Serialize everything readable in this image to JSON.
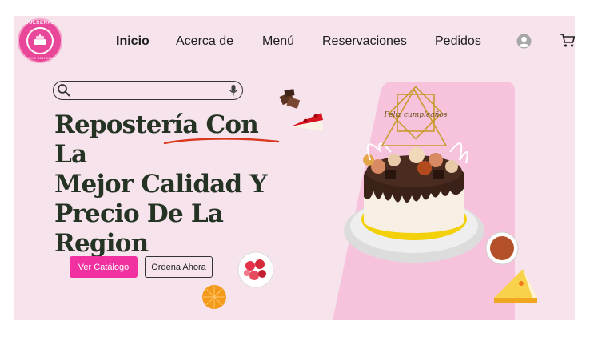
{
  "brand": {
    "logo_top": "DULCENAE",
    "logo_bottom": "HECHO CON AMOR"
  },
  "nav": {
    "items": [
      {
        "label": "Inicio",
        "active": true
      },
      {
        "label": "Acerca de",
        "active": false
      },
      {
        "label": "Menú",
        "active": false
      },
      {
        "label": "Reservaciones",
        "active": false
      },
      {
        "label": "Pedidos",
        "active": false
      }
    ],
    "icons": [
      "user-icon",
      "cart-icon"
    ]
  },
  "search": {
    "value": "",
    "placeholder": ""
  },
  "hero": {
    "title_line1": "Repostería Con La",
    "title_line2": "Mejor Calidad Y",
    "title_line3": "Precio De La",
    "title_line4": "Region",
    "primary_button": "Ver Catálogo",
    "secondary_button": "Ordena Ahora"
  },
  "cake_topper": "Feliz cumpleaños",
  "colors": {
    "background": "#f6e3ec",
    "accent": "#f0319f",
    "title": "#243323",
    "underline": "#d9381e",
    "panel": "#f7c3dc"
  }
}
